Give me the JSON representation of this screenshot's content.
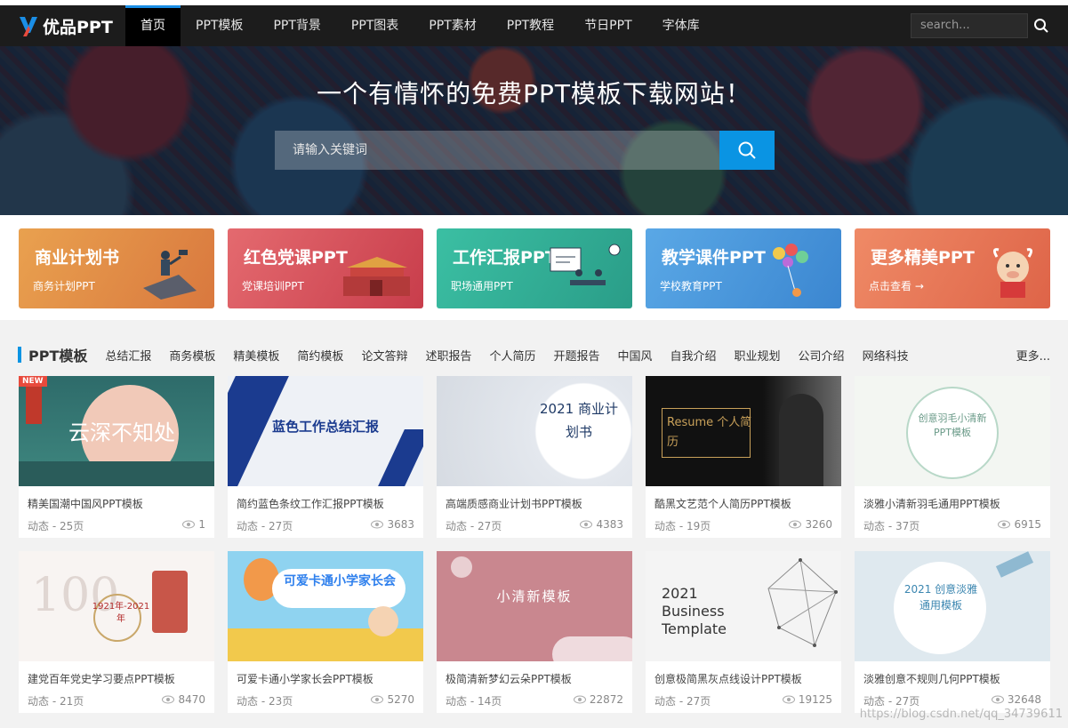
{
  "nav": {
    "logo_text": "优品PPT",
    "items": [
      "首页",
      "PPT模板",
      "PPT背景",
      "PPT图表",
      "PPT素材",
      "PPT教程",
      "节日PPT",
      "字体库"
    ],
    "search_placeholder": "search..."
  },
  "hero": {
    "title": "一个有情怀的免费PPT模板下载网站！",
    "search_placeholder": "请输入关键词"
  },
  "categories": [
    {
      "title": "商业计划书",
      "sub": "商务计划PPT",
      "color": "#e08a44"
    },
    {
      "title": "红色党课PPT",
      "sub": "党课培训PPT",
      "color": "#d9505a"
    },
    {
      "title": "工作汇报PPT",
      "sub": "职场通用PPT",
      "color": "#2fae95"
    },
    {
      "title": "教学课件PPT",
      "sub": "学校教育PPT",
      "color": "#3d92d6"
    },
    {
      "title": "更多精美PPT",
      "sub": "点击查看 →",
      "color": "#e4775a"
    }
  ],
  "section": {
    "title": "PPT模板",
    "tags": [
      "总结汇报",
      "商务模板",
      "精美模板",
      "简约模板",
      "论文答辩",
      "述职报告",
      "个人简历",
      "开题报告",
      "中国风",
      "自我介绍",
      "职业规划",
      "公司介绍",
      "网络科技"
    ],
    "more": "更多..."
  },
  "cards": [
    {
      "title": "精美国潮中国风PPT模板",
      "meta": "动态 - 25页",
      "views": "1",
      "badge": "NEW",
      "thumb_text": "云深不知处"
    },
    {
      "title": "简约蓝色条纹工作汇报PPT模板",
      "meta": "动态 - 27页",
      "views": "3683",
      "thumb_text": "蓝色工作总结汇报"
    },
    {
      "title": "高端质感商业计划书PPT模板",
      "meta": "动态 - 27页",
      "views": "4383",
      "thumb_text": "2021 商业计划书"
    },
    {
      "title": "酷黑文艺范个人简历PPT模板",
      "meta": "动态 - 19页",
      "views": "3260",
      "thumb_text": "Resume 个人简历"
    },
    {
      "title": "淡雅小清新羽毛通用PPT模板",
      "meta": "动态 - 37页",
      "views": "6915",
      "thumb_text": "创意羽毛小清新PPT模板"
    },
    {
      "title": "建党百年党史学习要点PPT模板",
      "meta": "动态 - 21页",
      "views": "8470",
      "thumb_text": "1921年-2021年"
    },
    {
      "title": "可爱卡通小学家长会PPT模板",
      "meta": "动态 - 23页",
      "views": "5270",
      "thumb_text": "可爱卡通小学家长会"
    },
    {
      "title": "极简清新梦幻云朵PPT模板",
      "meta": "动态 - 14页",
      "views": "22872",
      "thumb_text": "小清新模板"
    },
    {
      "title": "创意极简黑灰点线设计PPT模板",
      "meta": "动态 - 27页",
      "views": "19125",
      "thumb_text": "2021 Business Template"
    },
    {
      "title": "淡雅创意不规则几何PPT模板",
      "meta": "动态 - 27页",
      "views": "32648",
      "thumb_text": "2021 创意淡雅通用模板"
    }
  ],
  "watermark": "https://blog.csdn.net/qq_34739611"
}
